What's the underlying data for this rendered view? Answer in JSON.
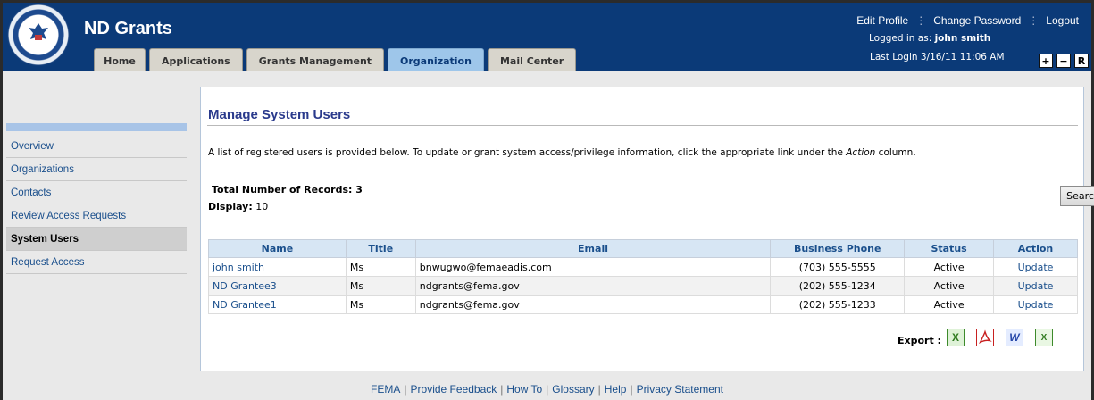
{
  "header": {
    "app_title": "ND Grants",
    "tabs": [
      {
        "label": "Home"
      },
      {
        "label": "Applications"
      },
      {
        "label": "Grants Management"
      },
      {
        "label": "Organization"
      },
      {
        "label": "Mail Center"
      }
    ],
    "active_tab": "Organization",
    "links": {
      "edit_profile": "Edit Profile",
      "change_password": "Change Password",
      "logout": "Logout"
    },
    "logged_in_label": "Logged in as:",
    "logged_in_user": "john smith",
    "last_login": "Last Login 3/16/11 11:06 AM",
    "zoom": {
      "plus": "+",
      "minus": "−",
      "reset": "R"
    }
  },
  "sidebar": {
    "items": [
      {
        "label": "Overview"
      },
      {
        "label": "Organizations"
      },
      {
        "label": "Contacts"
      },
      {
        "label": "Review Access Requests"
      },
      {
        "label": "System Users"
      },
      {
        "label": "Request Access"
      }
    ],
    "active_item": "System Users"
  },
  "main": {
    "title": "Manage System Users",
    "intro_before": "A list of registered users is provided below. To update or grant system access/privilege information, click the appropriate link under the ",
    "intro_emph": "Action",
    "intro_after": " column.",
    "total_label": "Total Number of Records: 3",
    "display_label": "Display:",
    "display_value": "10",
    "search_label": "Search",
    "table": {
      "columns": [
        "Name",
        "Title",
        "Email",
        "Business Phone",
        "Status",
        "Action"
      ],
      "rows": [
        {
          "name": "john smith",
          "title": "Ms",
          "email": "bnwugwo@femaeadis.com",
          "phone": "(703) 555-5555",
          "status": "Active",
          "action": "Update"
        },
        {
          "name": "ND Grantee3",
          "title": "Ms",
          "email": "ndgrants@fema.gov",
          "phone": "(202) 555-1234",
          "status": "Active",
          "action": "Update"
        },
        {
          "name": "ND Grantee1",
          "title": "Ms",
          "email": "ndgrants@fema.gov",
          "phone": "(202) 555-1233",
          "status": "Active",
          "action": "Update"
        }
      ]
    },
    "export_label": "Export :",
    "export_icons": [
      "excel-icon",
      "pdf-icon",
      "word-icon",
      "csv-icon"
    ]
  },
  "footer": {
    "links": [
      "FEMA",
      "Provide Feedback",
      "How To",
      "Glossary",
      "Help",
      "Privacy Statement"
    ],
    "separator": "|"
  },
  "colors": {
    "header_bg": "#0b3a78",
    "active_tab": "#9ec6ea",
    "link": "#1a4f8c",
    "table_header": "#d7e6f4",
    "title": "#2a3a8c"
  }
}
